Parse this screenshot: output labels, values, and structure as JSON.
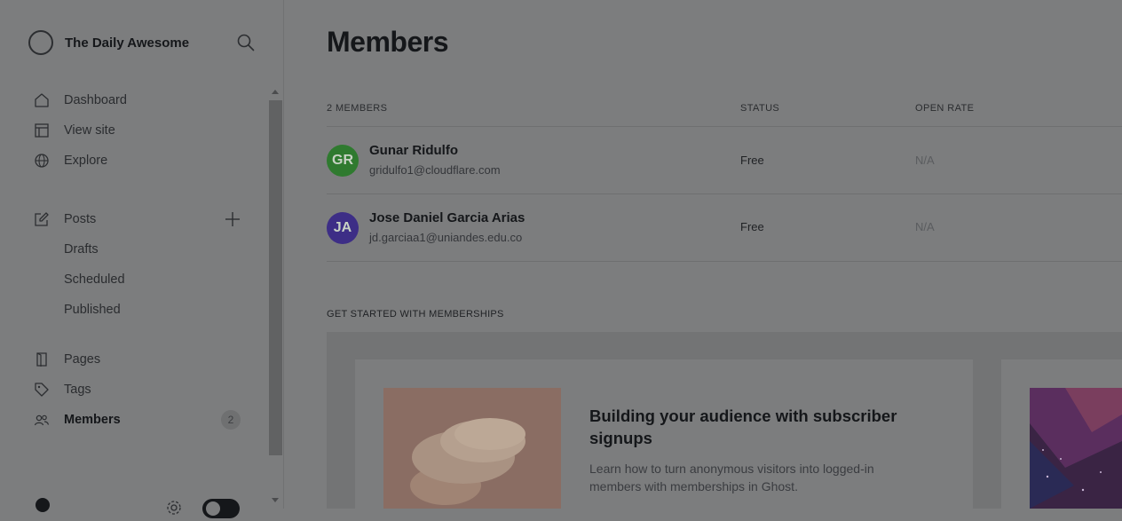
{
  "brand": {
    "name": "The Daily Awesome"
  },
  "nav": {
    "dashboard": "Dashboard",
    "view_site": "View site",
    "explore": "Explore",
    "posts": "Posts",
    "drafts": "Drafts",
    "scheduled": "Scheduled",
    "published": "Published",
    "pages": "Pages",
    "tags": "Tags",
    "members": "Members",
    "members_count": "2"
  },
  "main": {
    "title": "Members",
    "table": {
      "headers": {
        "members": "2 MEMBERS",
        "status": "STATUS",
        "open_rate": "OPEN RATE"
      },
      "rows": [
        {
          "initials": "GR",
          "name": "Gunar Ridulfo",
          "email": "gridulfo1@cloudflare.com",
          "status": "Free",
          "open_rate": "N/A",
          "avatar_color": "#2f7a2f"
        },
        {
          "initials": "JA",
          "name": "Jose Daniel Garcia Arias",
          "email": "jd.garciaa1@uniandes.edu.co",
          "status": "Free",
          "open_rate": "N/A",
          "avatar_color": "#3d2e86"
        }
      ]
    },
    "get_started": {
      "label": "GET STARTED WITH MEMBERSHIPS",
      "card": {
        "title": "Building your audience with subscriber signups",
        "description": "Learn how to turn anonymous visitors into logged-in members with memberships in Ghost."
      }
    }
  },
  "colors": {
    "overlay_bg": "#7c7d7e",
    "text_dark": "#15171a"
  }
}
